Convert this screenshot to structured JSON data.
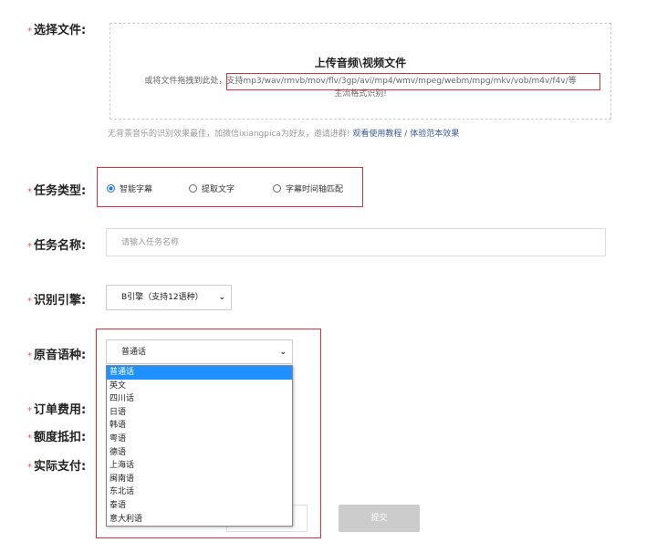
{
  "labels": {
    "file": "选择文件:",
    "task_type": "任务类型:",
    "task_name": "任务名称:",
    "engine": "识别引擎:",
    "language": "原音语种:",
    "order_fee": "订单费用:",
    "quota": "额度抵扣:",
    "actual_pay": "实际支付:"
  },
  "star": "*",
  "upload": {
    "title": "上传音频\\视频文件",
    "desc_prefix": "或将文件拖拽到此处，支持",
    "formats": "mp3/wav/rmvb/mov/flv/3gp/avi/mp4/wmv/mpeg/webm/mpg/mkv/vob/m4v/f4v/",
    "desc_suffix": "等",
    "desc_line2": "主流格式识别!"
  },
  "hint": {
    "text": "无背景音乐的识别效果最佳，加微信ixiangpica为好友，邀请进群! ",
    "link1": "观看使用教程",
    "sep": " / ",
    "link2": "体验范本效果"
  },
  "task_types": [
    {
      "label": "智能字幕",
      "checked": true
    },
    {
      "label": "提取文字",
      "checked": false
    },
    {
      "label": "字幕时间轴匹配",
      "checked": false
    }
  ],
  "task_name_placeholder": "请输入任务名称",
  "engine_value": "B引擎（支持12语种）",
  "language": {
    "value": "普通话",
    "options": [
      "普通话",
      "英文",
      "四川话",
      "日语",
      "韩语",
      "粤语",
      "德语",
      "上海话",
      "闽南语",
      "东北话",
      "泰语",
      "意大利语"
    ]
  },
  "submit": "提交",
  "colors": {
    "highlight": "#d9303e",
    "selected": "#1e90ff"
  }
}
